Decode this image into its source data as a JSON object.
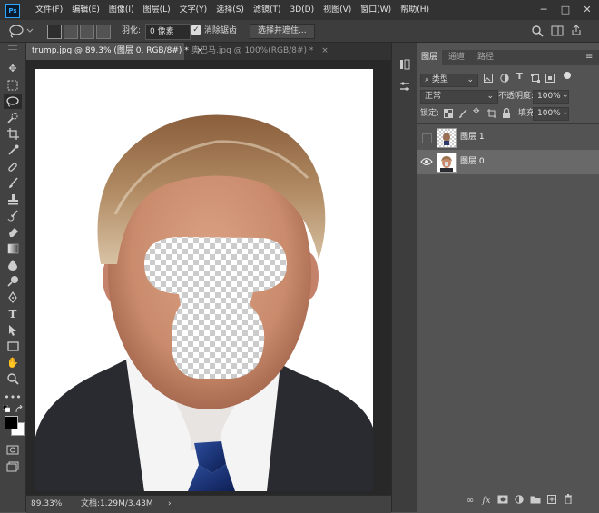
{
  "app": {
    "logo_text": "Ps",
    "window_controls": [
      "─",
      "□",
      "✕"
    ]
  },
  "menu": [
    "文件(F)",
    "编辑(E)",
    "图像(I)",
    "图层(L)",
    "文字(Y)",
    "选择(S)",
    "滤镜(T)",
    "3D(D)",
    "视图(V)",
    "窗口(W)",
    "帮助(H)"
  ],
  "options": {
    "feather_label": "羽化:",
    "feather_value": "0 像素",
    "antialias_checked": true,
    "antialias_label": "消除锯齿",
    "select_mask_label": "选择并遮住..."
  },
  "doc_tabs": [
    {
      "label": "trump.jpg @ 89.3% (图层 0, RGB/8#) *",
      "active": true,
      "close": "×"
    },
    {
      "label": "奥巴马.jpg @ 100%(RGB/8#) *",
      "active": false,
      "close": "×"
    }
  ],
  "status": {
    "zoom": "89.33%",
    "doc_info": "文档:1.29M/3.43M",
    "arrow": "›"
  },
  "layers_panel": {
    "tabs": [
      "图层",
      "通道",
      "路径"
    ],
    "filter_kind": "类型",
    "blend_mode": "正常",
    "opacity_label": "不透明度:",
    "opacity_value": "100%",
    "lock_label": "锁定:",
    "fill_label": "填充:",
    "fill_value": "100%",
    "layers": [
      {
        "name": "图层 1",
        "visible": false,
        "selected": false
      },
      {
        "name": "图层 0",
        "visible": true,
        "selected": true
      }
    ]
  },
  "colors": {
    "ui_dark": "#323232",
    "panel": "#535353",
    "accent": "#31a8ff"
  }
}
